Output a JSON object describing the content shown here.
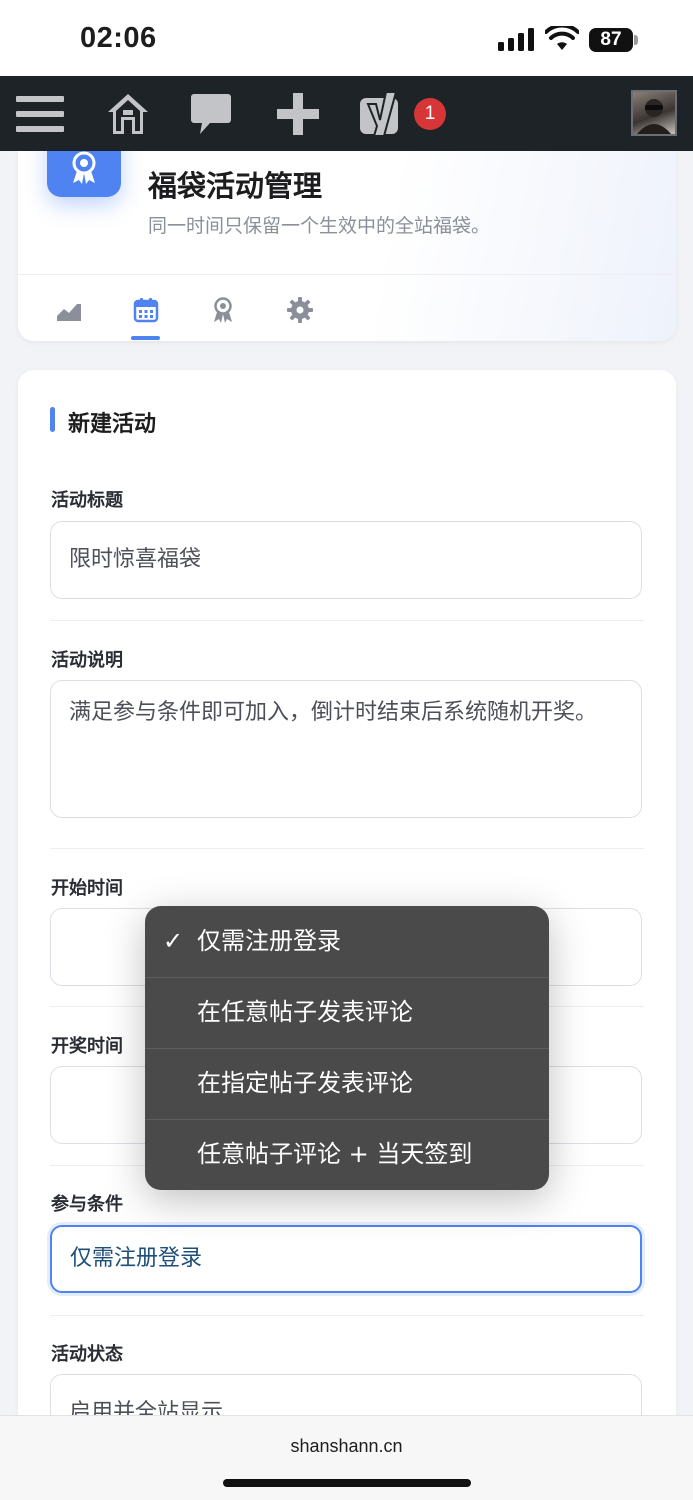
{
  "status_bar": {
    "time": "02:06",
    "battery": "87"
  },
  "admin_bar": {
    "notification_count": "1",
    "icons": [
      "menu-icon",
      "home-icon",
      "comment-icon",
      "plus-icon",
      "yoast-icon"
    ]
  },
  "header": {
    "title": "福袋活动管理",
    "subtitle": "同一时间只保留一个生效中的全站福袋。",
    "tabs": [
      "stats-icon",
      "calendar-icon",
      "award-icon",
      "settings-icon"
    ],
    "active_tab": "calendar-icon",
    "accent_color": "#4f83f1"
  },
  "form": {
    "section_title": "新建活动",
    "fields": {
      "title": {
        "label": "活动标题",
        "value": "限时惊喜福袋"
      },
      "description": {
        "label": "活动说明",
        "value": "满足参与条件即可加入，倒计时结束后系统随机开奖。"
      },
      "start_time": {
        "label": "开始时间",
        "value": ""
      },
      "draw_time": {
        "label": "开奖时间",
        "value": ""
      },
      "condition": {
        "label": "参与条件",
        "value": "仅需注册登录"
      },
      "status": {
        "label": "活动状态",
        "value": "启用并全站显示"
      }
    }
  },
  "dropdown": {
    "options": [
      {
        "label": "仅需注册登录",
        "selected": true
      },
      {
        "label": "在任意帖子发表评论",
        "selected": false
      },
      {
        "label": "在指定帖子发表评论",
        "selected": false
      },
      {
        "label": "任意帖子评论 + 当天签到",
        "selected": false
      }
    ],
    "check_mark": "✓"
  },
  "footer": {
    "domain": "shanshann.cn"
  }
}
